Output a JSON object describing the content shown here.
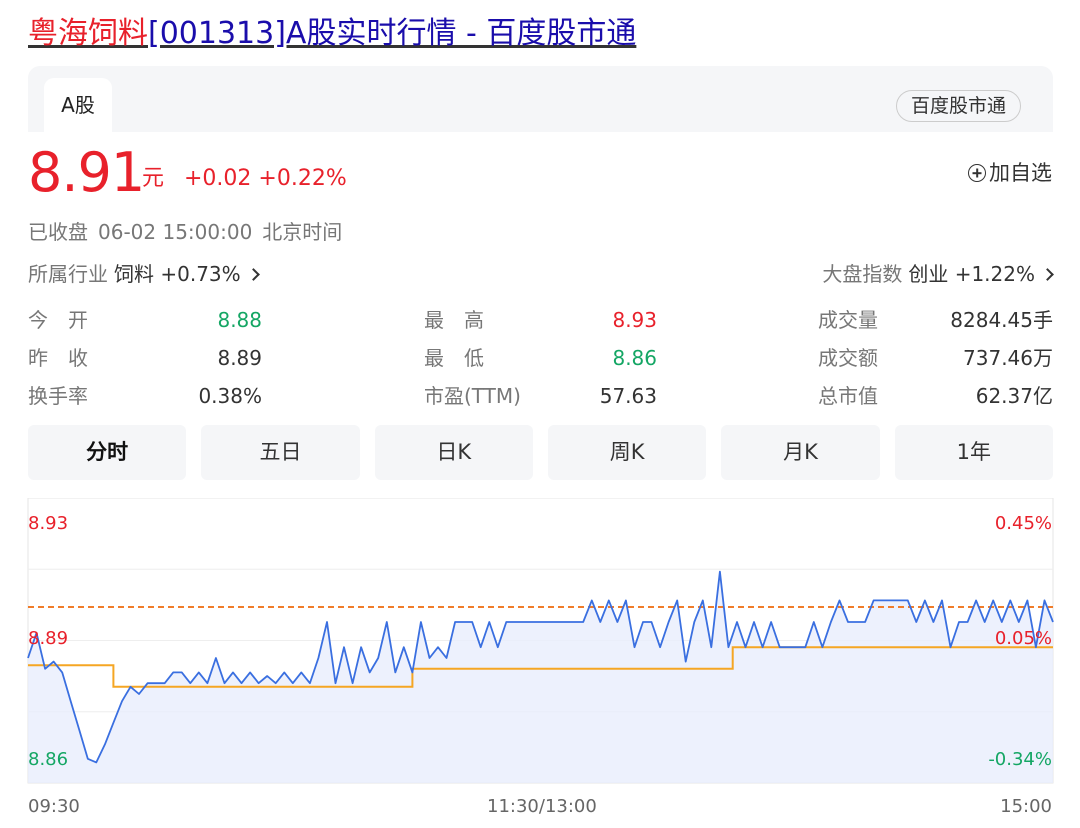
{
  "header": {
    "title_name": "粤海饲料",
    "title_rest": "[001313]A股实时行情 - 百度股市通"
  },
  "card": {
    "tab_label": "A股",
    "badge": "百度股市通"
  },
  "quote": {
    "price": "8.91",
    "unit": "元",
    "change": "+0.02 +0.22%",
    "add_watch": "加自选"
  },
  "status": {
    "state": "已收盘",
    "time": "06-02 15:00:00",
    "zone": "北京时间"
  },
  "industry": {
    "label": "所属行业",
    "value": "饲料 +0.73%"
  },
  "market_index": {
    "label": "大盘指数",
    "value": "创业 +1.22%"
  },
  "stats": [
    [
      {
        "label": "今　开",
        "value": "8.88"
      },
      {
        "label": "最　高",
        "value": "8.93"
      },
      {
        "label": "成交量",
        "value": "8284.45手"
      }
    ],
    [
      {
        "label": "昨　收",
        "value": "8.89"
      },
      {
        "label": "最　低",
        "value": "8.86"
      },
      {
        "label": "成交额",
        "value": "737.46万"
      }
    ],
    [
      {
        "label": "换手率",
        "value": "0.38%"
      },
      {
        "label": "市盈(TTM)",
        "value": "57.63"
      },
      {
        "label": "总市值",
        "value": "62.37亿"
      }
    ]
  ],
  "period_tabs": [
    "分时",
    "五日",
    "日K",
    "周K",
    "月K",
    "1年"
  ],
  "colors": {
    "up": "#e8212b",
    "down": "#14a664",
    "line": "#3a6fe0",
    "avg": "#f5a623",
    "link": "#1a0dab"
  },
  "chart_data": {
    "type": "line",
    "y_labels_left": [
      "8.93",
      "8.89",
      "8.86"
    ],
    "y_labels_right": [
      "0.45%",
      "0.05%",
      "-0.34%"
    ],
    "x_labels": [
      "09:30",
      "11:30/13:00",
      "15:00"
    ],
    "prev_close": 8.89,
    "ylim": [
      8.86,
      8.93
    ],
    "series": [
      {
        "values": [
          8.89,
          8.889,
          8.887,
          8.885,
          8.88,
          8.875,
          8.87,
          8.866,
          8.86,
          8.862,
          8.864,
          8.866,
          8.868,
          8.87,
          8.872,
          8.874,
          8.876,
          8.878,
          8.88,
          8.882,
          8.884,
          8.886,
          8.888,
          8.889,
          8.888,
          8.889,
          8.888,
          8.889,
          8.888,
          8.889,
          8.888,
          8.889,
          8.888,
          8.887,
          8.886,
          8.888,
          8.889,
          8.888,
          8.889,
          8.888,
          8.889,
          8.888,
          8.889,
          8.888,
          8.89,
          8.892,
          8.894,
          8.896,
          8.898,
          8.9,
          8.9,
          8.899,
          8.9,
          8.899,
          8.9,
          8.899,
          8.9,
          8.9,
          8.9,
          8.9,
          8.9,
          8.9,
          8.9,
          8.9,
          8.9,
          8.9,
          8.9,
          8.9,
          8.9,
          8.9,
          8.9,
          8.9,
          8.9,
          8.9,
          8.9,
          8.9,
          8.9,
          8.9,
          8.9,
          8.9,
          8.9,
          8.9,
          8.9,
          8.9,
          8.9,
          8.9,
          8.9,
          8.9,
          8.9,
          8.9,
          8.9,
          8.9,
          8.9,
          8.9,
          8.9,
          8.9,
          8.9,
          8.9,
          8.9,
          8.9,
          8.9,
          8.9,
          8.9,
          8.9,
          8.9,
          8.9,
          8.9,
          8.9,
          8.9,
          8.9,
          8.9,
          8.9,
          8.9,
          8.9,
          8.9,
          8.9,
          8.9,
          8.9,
          8.9,
          8.9,
          8.9,
          8.9,
          8.9,
          8.9,
          8.9,
          8.9,
          8.9,
          8.9,
          8.9,
          8.9,
          8.9,
          8.9,
          8.9,
          8.9,
          8.9,
          8.9,
          8.9,
          8.9,
          8.9,
          8.9,
          8.9,
          8.9,
          8.9,
          8.9,
          8.9,
          8.9,
          8.9,
          8.9,
          8.9,
          8.9,
          8.9,
          8.9,
          8.9,
          8.9,
          8.9,
          8.9,
          8.9,
          8.9,
          8.9,
          8.9,
          8.9,
          8.9,
          8.9,
          8.9,
          8.9,
          8.9,
          8.9,
          8.9,
          8.9,
          8.9,
          8.9,
          8.9,
          8.9,
          8.9,
          8.9,
          8.9,
          8.9,
          8.9,
          8.9,
          8.9,
          8.9,
          8.9,
          8.9,
          8.9,
          8.9,
          8.9,
          8.9,
          8.9,
          8.9,
          8.9,
          8.9,
          8.9,
          8.9,
          8.9,
          8.9,
          8.9,
          8.9,
          8.9,
          8.9,
          8.9,
          8.9,
          8.9,
          8.9,
          8.9,
          8.9,
          8.9,
          8.9,
          8.9,
          8.9,
          8.9,
          8.9,
          8.9,
          8.9,
          8.9,
          8.9,
          8.9,
          8.9,
          8.9,
          8.9,
          8.9,
          8.9,
          8.9,
          8.9,
          8.9,
          8.9,
          8.9,
          8.9,
          8.9,
          8.9,
          8.9,
          8.9,
          8.9,
          8.9,
          8.9,
          8.9,
          8.9,
          8.9,
          8.9,
          8.9,
          8.9,
          8.9,
          8.9,
          8.9,
          8.9,
          8.9,
          8.9,
          8.9,
          8.9
        ]
      }
    ]
  }
}
